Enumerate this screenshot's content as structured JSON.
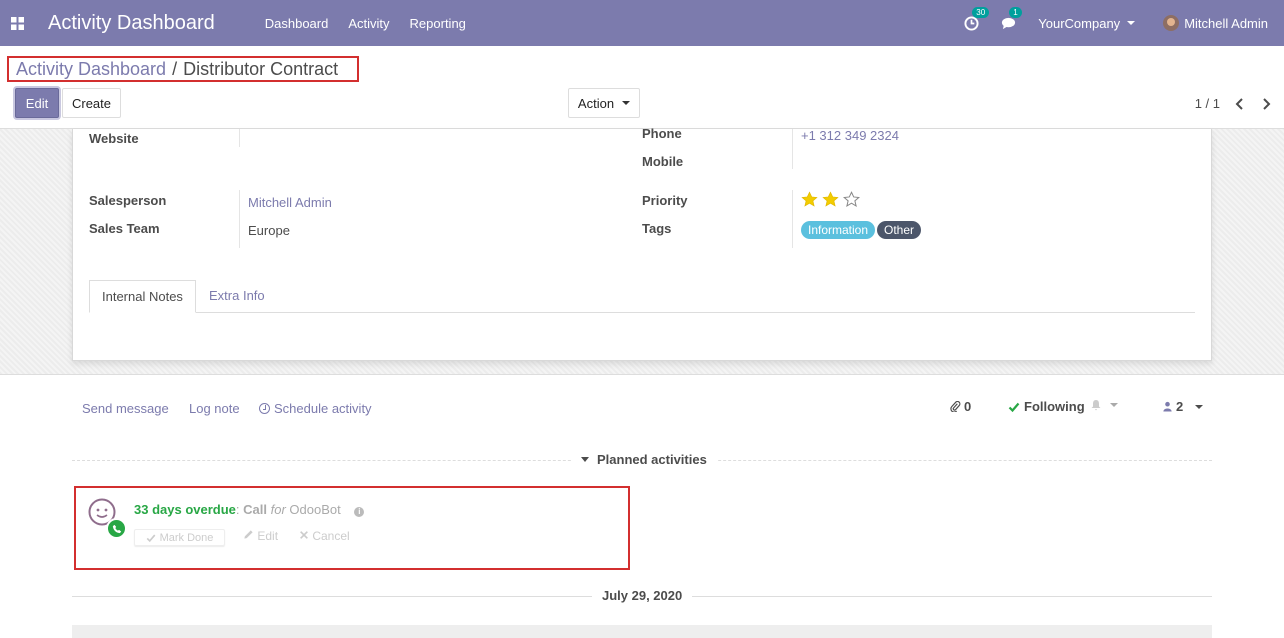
{
  "navbar": {
    "brand": "Activity Dashboard",
    "menu": [
      "Dashboard",
      "Activity",
      "Reporting"
    ],
    "activity_count": "30",
    "message_count": "1",
    "company": "YourCompany",
    "user": "Mitchell Admin"
  },
  "breadcrumb": {
    "parent": "Activity Dashboard",
    "separator": "/",
    "current": "Distributor Contract"
  },
  "control_panel": {
    "edit_label": "Edit",
    "create_label": "Create",
    "action_label": "Action",
    "pager": "1 / 1"
  },
  "form": {
    "website_label": "Website",
    "website_value": "",
    "phone_label": "Phone",
    "phone_value": "+1 312 349 2324",
    "mobile_label": "Mobile",
    "mobile_value": "",
    "salesperson_label": "Salesperson",
    "salesperson_value": "Mitchell Admin",
    "sales_team_label": "Sales Team",
    "sales_team_value": "Europe",
    "priority_label": "Priority",
    "priority_value": 2,
    "priority_max": 3,
    "tags_label": "Tags",
    "tags": [
      {
        "label": "Information",
        "color": "#5bc0de"
      },
      {
        "label": "Other",
        "color": "#4c566a"
      }
    ],
    "tabs": [
      "Internal Notes",
      "Extra Info"
    ]
  },
  "chatter": {
    "send_message": "Send message",
    "log_note": "Log note",
    "schedule_activity": "Schedule activity",
    "attachments": "0",
    "following": "Following",
    "followers": "2",
    "planned_title": "Planned activities",
    "activity": {
      "due": "33 days overdue",
      "colon": ":",
      "type": "Call",
      "for": "for",
      "user": "OdooBot",
      "mark_done": "Mark Done",
      "edit": "Edit",
      "cancel": "Cancel"
    },
    "date_separator": "July 29, 2020"
  },
  "colors": {
    "brand": "#7c7bad",
    "overdue": "#28a745",
    "highlight": "#d32f2f"
  }
}
